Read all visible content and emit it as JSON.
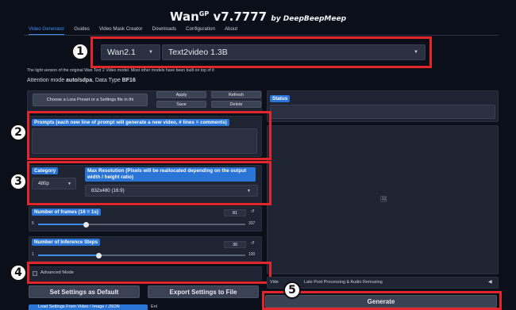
{
  "app": {
    "title_main": "Wan",
    "title_sup": "GP",
    "title_version": " v7.7777 ",
    "title_by": "by DeepBeepMeep"
  },
  "tabs": [
    {
      "label": "Video Generator"
    },
    {
      "label": "Guides"
    },
    {
      "label": "Video Mask Creator"
    },
    {
      "label": "Downloads"
    },
    {
      "label": "Configuration"
    },
    {
      "label": "About"
    }
  ],
  "model": {
    "family": "Wan2.1",
    "variant": "Text2video 1.3B"
  },
  "info": {
    "description": "The light version of the original Wan Text 2 Video model. Most other models have been built on top of it",
    "attention_prefix": "Attention mode ",
    "attention_value": "auto/sdpa",
    "datatype_prefix": ", Data Type ",
    "datatype_value": "BF16"
  },
  "lora": {
    "select_label": "Choose a Lora Preset or a Settings file in thi",
    "apply": "Apply",
    "refresh": "Refresh",
    "save": "Save",
    "delete": "Delete"
  },
  "status": {
    "label": "Status"
  },
  "prompt": {
    "label": "Prompts (each new line of prompt will generate a new video, # lines = comments)",
    "value": ""
  },
  "category": {
    "label": "Category",
    "value": "480p"
  },
  "resolution": {
    "label": "Max Resolution (Pixels will be reallocated depending on the output width / height ratio)",
    "value": "832x480 (16:9)"
  },
  "frames": {
    "label": "Number of frames (16 = 1s)",
    "value": "81",
    "min": "5",
    "max": "337",
    "fraction": 0.23
  },
  "steps": {
    "label": "Number of Inference Steps",
    "value": "30",
    "min": "1",
    "max": "100",
    "fraction": 0.29
  },
  "advanced": {
    "label": "Advanced Mode",
    "checked": false
  },
  "buttons": {
    "set_default": "Set Settings as Default",
    "export": "Export Settings to File",
    "generate": "Generate"
  },
  "postproc": {
    "label": "Video Post Processing & Audio Remuxing",
    "label_visible": "Late Post Processing & Audio Remuxing",
    "label_prefix": "Vide"
  },
  "bottom": {
    "load_label": "Load Settings From Video / Image / JSON",
    "extra": "Enl"
  },
  "markers": [
    "1",
    "2",
    "3",
    "4",
    "5"
  ],
  "colors": {
    "background": "#0b0f19",
    "accent": "#2a74d6",
    "highlight": "#e1262c"
  }
}
